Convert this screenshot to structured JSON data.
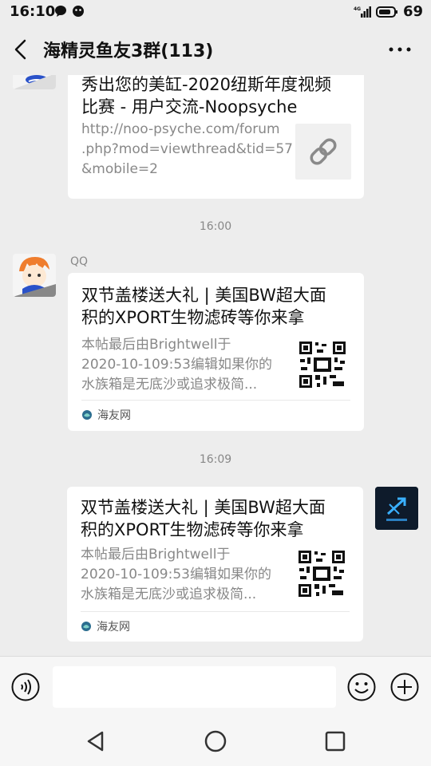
{
  "status_bar": {
    "time": "16:10",
    "network": "4G",
    "battery": "69"
  },
  "header": {
    "title": "海精灵鱼友3群(113)"
  },
  "messages": [
    {
      "title_line1": "秀出您的美缸-2020纽斯年度视频",
      "title_line2": "比赛 - 用户交流-Noopsyche",
      "desc_line1": "http://noo-psyche.com/forum",
      "desc_line2": ".php?mod=viewthread&tid=57",
      "desc_line3": "&mobile=2"
    },
    {
      "timestamp": "16:00",
      "sender": "QQ",
      "title_line1": "双节盖楼送大礼 | 美国BW超大面",
      "title_line2": "积的XPORT生物滤砖等你来拿",
      "desc_line1": "本帖最后由Brightwell于",
      "desc_line2": "2020-10-109:53编辑如果你的",
      "desc_line3": "水族箱是无底沙或追求极简...",
      "source": "海友网"
    },
    {
      "timestamp": "16:09",
      "title_line1": "双节盖楼送大礼 | 美国BW超大面",
      "title_line2": "积的XPORT生物滤砖等你来拿",
      "desc_line1": "本帖最后由Brightwell于",
      "desc_line2": "2020-10-109:53编辑如果你的",
      "desc_line3": "水族箱是无底沙或追求极简...",
      "source": "海友网"
    }
  ],
  "input": {
    "placeholder": ""
  },
  "colors": {
    "background": "#ededed",
    "card": "#ffffff",
    "secondary_text": "#888888"
  }
}
